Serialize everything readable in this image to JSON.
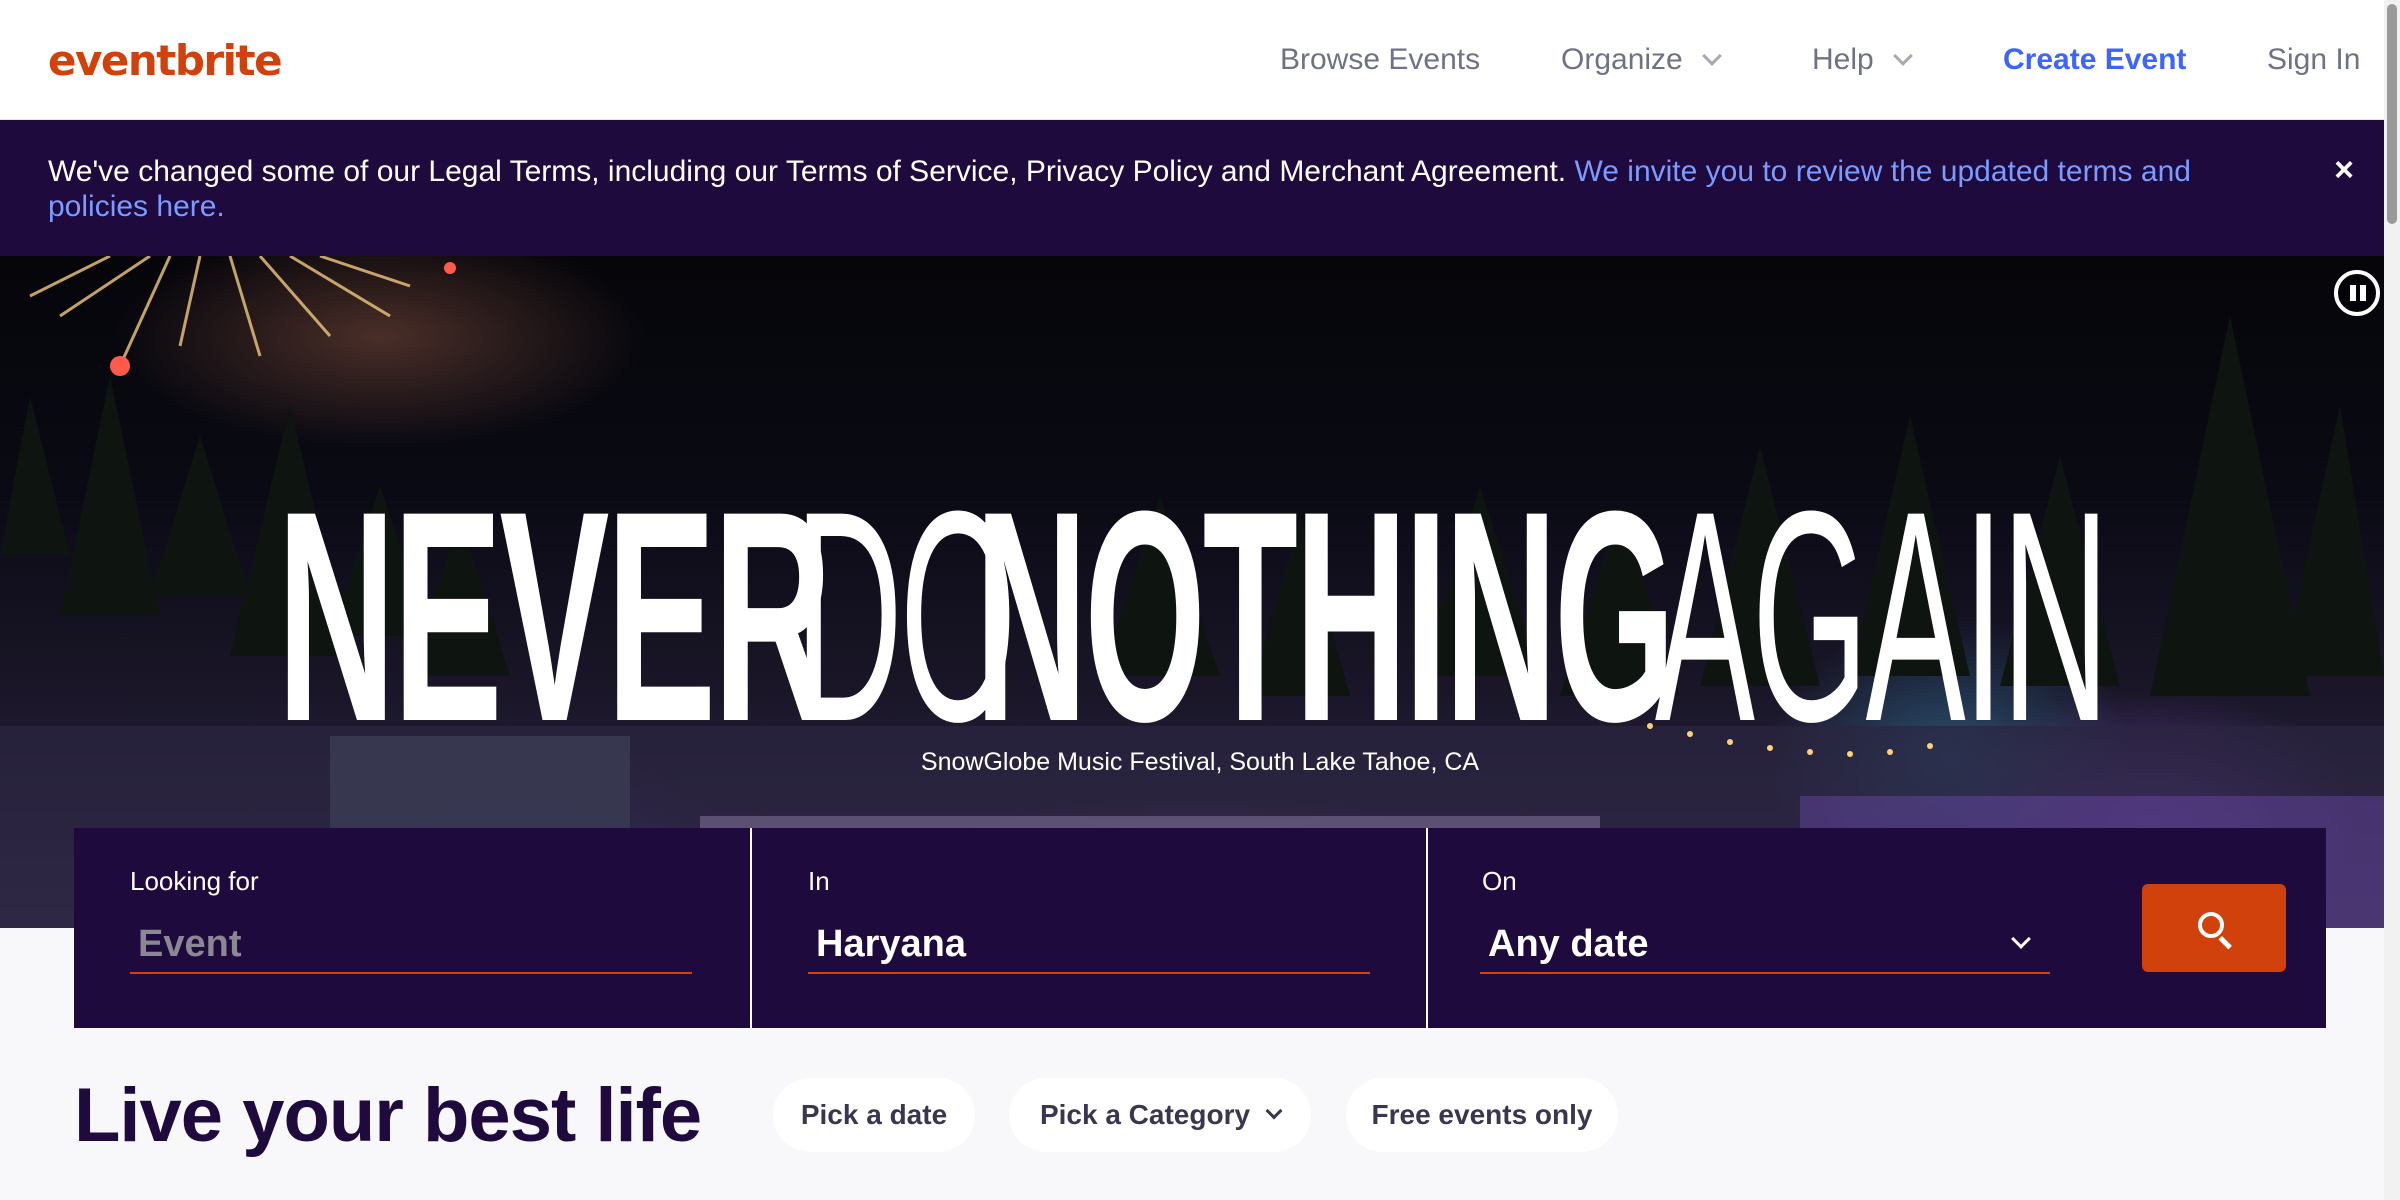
{
  "header": {
    "logo": "eventbrite",
    "nav": {
      "browse": "Browse Events",
      "organize": "Organize",
      "help": "Help",
      "create": "Create Event",
      "signin": "Sign In"
    }
  },
  "banner": {
    "text": "We've changed some of our Legal Terms, including our Terms of Service, Privacy Policy and Merchant Agreement.",
    "link": "We invite you to review the updated terms and policies here.",
    "close": "×"
  },
  "hero": {
    "title_words": [
      "NEVER",
      "DO",
      "NOTHING",
      "AGAIN"
    ],
    "caption": "SnowGlobe Music Festival, South Lake Tahoe, CA"
  },
  "search": {
    "looking_for": {
      "label": "Looking for",
      "placeholder": "Event",
      "value": ""
    },
    "location": {
      "label": "In",
      "value": "Haryana"
    },
    "date": {
      "label": "On",
      "value": "Any date"
    }
  },
  "section": {
    "title": "Live your best life",
    "filters": [
      "Pick a date",
      "Pick a Category",
      "Free events only"
    ]
  },
  "colors": {
    "brand": "#d1410c",
    "navy": "#1e0a3c",
    "link": "#3d64ff",
    "banner_link": "#7d9bff"
  },
  "icons": [
    "chevron-down-icon",
    "close-icon",
    "pause-icon",
    "search-icon"
  ]
}
